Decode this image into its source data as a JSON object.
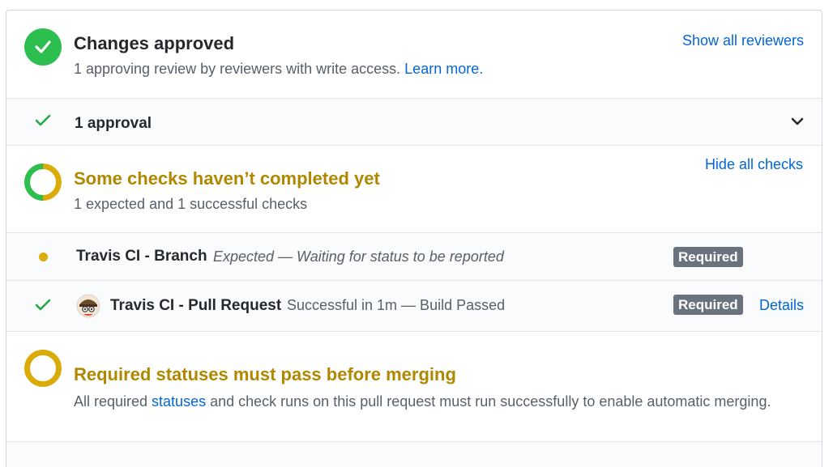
{
  "approved": {
    "title": "Changes approved",
    "subtitle_text": "1 approving review by reviewers with write access.",
    "learn_more": "Learn more.",
    "show_reviewers": "Show all reviewers",
    "approval_row_label": "1 approval"
  },
  "checks": {
    "title": "Some checks haven’t completed yet",
    "subtitle": "1 expected and 1 successful checks",
    "hide_checks": "Hide all checks",
    "items": [
      {
        "name": "Travis CI - Branch",
        "description": "Expected — Waiting for status to be reported",
        "badge": "Required",
        "status": "pending"
      },
      {
        "name": "Travis CI - Pull Request",
        "description": "Successful in 1m — Build Passed",
        "badge": "Required",
        "details": "Details",
        "status": "success"
      }
    ]
  },
  "required": {
    "title": "Required statuses must pass before merging",
    "subtitle_pre": "All required ",
    "subtitle_link": "statuses",
    "subtitle_post": " and check runs on this pull request must run successfully to enable automatic merging."
  },
  "colors": {
    "success": "#2cbe4e",
    "pending": "#dbab09",
    "link": "#0366d6",
    "badge": "#6a737d"
  },
  "checks_progress": {
    "successful": 1,
    "expected": 1
  }
}
